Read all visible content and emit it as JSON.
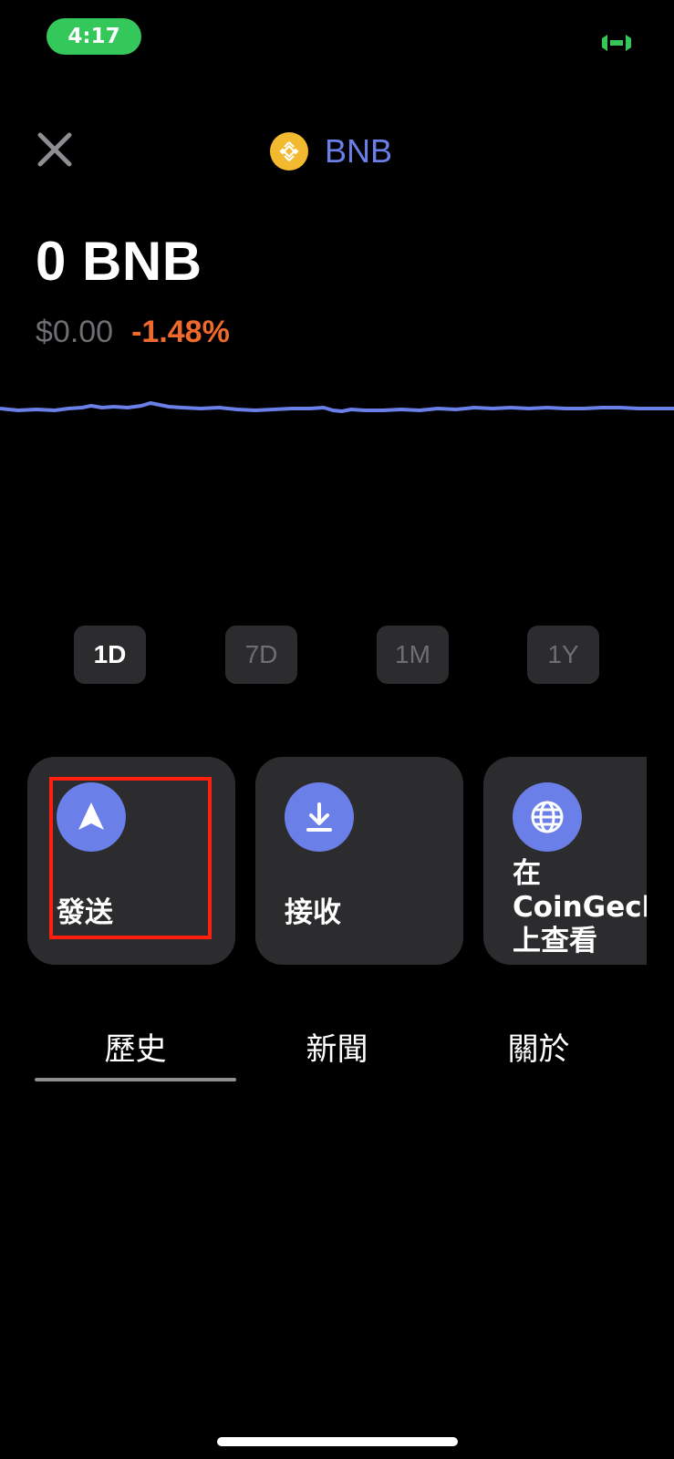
{
  "status_bar": {
    "time": "4:17",
    "right_icon": "screen-mirroring-icon",
    "time_bg_color": "#34c759"
  },
  "header": {
    "close_icon": "close-icon",
    "asset_icon": "bnb-logo-icon",
    "asset_name": "BNB"
  },
  "balance": {
    "amount": "0 BNB",
    "fiat": "$0.00",
    "change": "-1.48%"
  },
  "colors": {
    "accent": "#6a7fe8",
    "negative": "#f06a2c",
    "card": "#2c2c2e",
    "highlight": "#ff1f0f"
  },
  "time_ranges": [
    {
      "label": "1D",
      "selected": true
    },
    {
      "label": "7D",
      "selected": false
    },
    {
      "label": "1M",
      "selected": false
    },
    {
      "label": "1Y",
      "selected": false
    }
  ],
  "actions": [
    {
      "label": "發送",
      "icon": "send-arrow-icon",
      "highlighted": true
    },
    {
      "label": "接收",
      "icon": "download-icon",
      "highlighted": false
    },
    {
      "label": "在\nCoinGecko\n上查看",
      "icon": "globe-icon",
      "highlighted": false
    }
  ],
  "tabs": [
    {
      "label": "歷史",
      "selected": true
    },
    {
      "label": "新聞",
      "selected": false
    },
    {
      "label": "關於",
      "selected": false
    }
  ]
}
